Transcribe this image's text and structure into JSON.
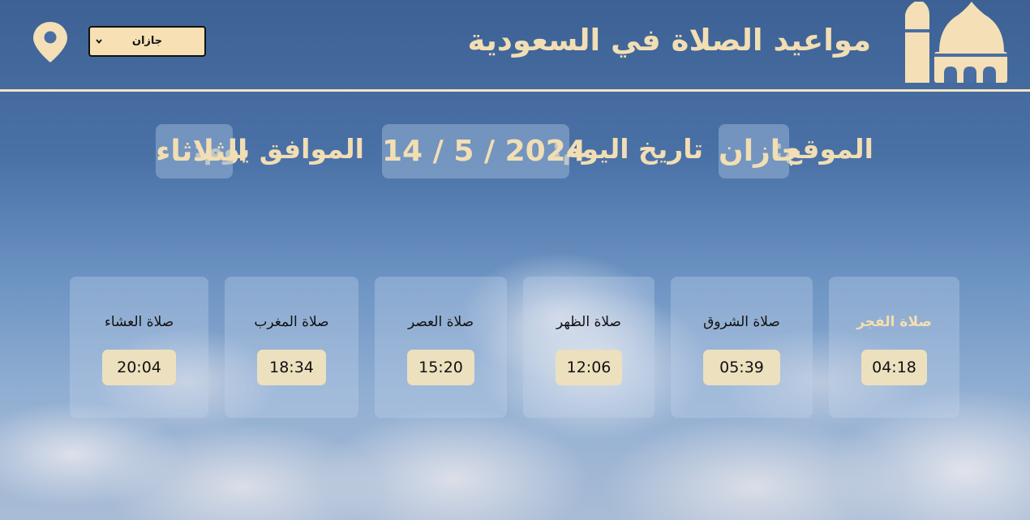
{
  "header": {
    "title": "مواعيد الصلاة في السعودية",
    "city_select_value": "جازان",
    "logo_icon": "mosque-icon",
    "location_icon": "map-pin-icon"
  },
  "info": {
    "location_label": "الموقع:",
    "location_value": "جازان",
    "date_label": "تاريخ اليوم:",
    "date_value": "14 / 5 / 2024",
    "day_label": "الموافق يوم:",
    "day_value": "الثلاثاء"
  },
  "prayers": [
    {
      "name": "صلاة الفجر",
      "time": "04:18"
    },
    {
      "name": "صلاة الشروق",
      "time": "05:39"
    },
    {
      "name": "صلاة الظهر",
      "time": "12:06"
    },
    {
      "name": "صلاة العصر",
      "time": "15:20"
    },
    {
      "name": "صلاة المغرب",
      "time": "18:34"
    },
    {
      "name": "صلاة العشاء",
      "time": "20:04"
    }
  ],
  "colors": {
    "accent": "#f2deb4",
    "sky": "#4a71a6",
    "time_pill": "#ece0bf"
  }
}
